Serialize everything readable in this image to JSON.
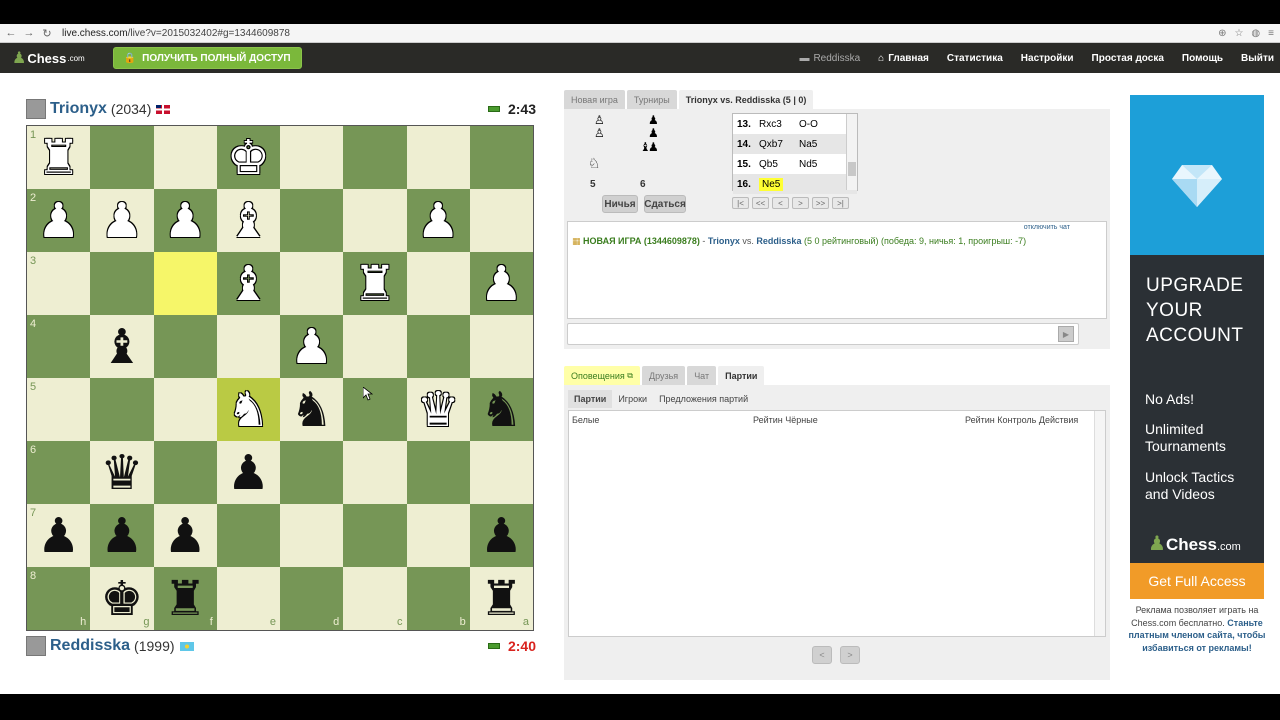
{
  "browser": {
    "url_host": "live.chess.com",
    "url_path": "/live?v=2015032402#g=1344609878",
    "back_icon": "back-arrow-icon",
    "forward_icon": "forward-arrow-icon",
    "reload_icon": "reload-icon"
  },
  "site": {
    "logo_text": "Chess",
    "logo_suffix": ".com",
    "full_access_label": "ПОЛУЧИТЬ ПОЛНЫЙ ДОСТУП",
    "nav": {
      "username": "Reddisska",
      "home": "Главная",
      "stats": "Статистика",
      "settings": "Настройки",
      "simple_board": "Простая доска",
      "help": "Помощь",
      "logout": "Выйти"
    }
  },
  "top_player": {
    "name": "Trionyx",
    "rating": "(2034)",
    "clock": "2:43",
    "clock_color": "#222222"
  },
  "bottom_player": {
    "name": "Reddisska",
    "rating": "(1999)",
    "clock": "2:40",
    "clock_color": "#d9231e"
  },
  "board": {
    "ranks": [
      "1",
      "2",
      "3",
      "4",
      "5",
      "6",
      "7",
      "8"
    ],
    "files": [
      "h",
      "g",
      "f",
      "e",
      "d",
      "c",
      "b",
      "a"
    ],
    "pieces": [
      [
        "wR",
        "",
        "",
        "wK",
        "",
        "",
        "",
        ""
      ],
      [
        "wP",
        "wP",
        "wP",
        "wB",
        "",
        "",
        "wP",
        ""
      ],
      [
        "",
        "",
        "",
        "wB",
        "",
        "wR",
        "",
        "wP"
      ],
      [
        "",
        "bB",
        "",
        "",
        "wP",
        "",
        "",
        ""
      ],
      [
        "",
        "",
        "",
        "wN",
        "bN",
        "",
        "wQ",
        "bN"
      ],
      [
        "",
        "bQ",
        "",
        "bP",
        "",
        "",
        "",
        ""
      ],
      [
        "bP",
        "bP",
        "bP",
        "",
        "",
        "",
        "",
        "bP"
      ],
      [
        "",
        "bK",
        "bR",
        "",
        "",
        "",
        "",
        "bR"
      ]
    ],
    "highlight": [
      [
        2,
        2
      ],
      [
        4,
        3
      ]
    ]
  },
  "panel": {
    "tabs": [
      "Новая игра",
      "Турниры",
      "Trionyx vs. Reddisska (5 | 0)"
    ],
    "captured_white_count": "5",
    "captured_black_count": "6",
    "draw_label": "Ничья",
    "resign_label": "Сдаться",
    "moves": [
      {
        "num": "13.",
        "white": "Rxc3",
        "black": "O-O"
      },
      {
        "num": "14.",
        "white": "Qxb7",
        "black": "Na5"
      },
      {
        "num": "15.",
        "white": "Qb5",
        "black": "Nd5"
      },
      {
        "num": "16.",
        "white": "Ne5",
        "black": ""
      }
    ],
    "nav_buttons": [
      "|<",
      "<<",
      "<",
      ">",
      ">>",
      ">|"
    ],
    "disable_chat": "отключить чат",
    "chat": {
      "new_game": "НОВАЯ ИГРА (1344609878)",
      "dash": " - ",
      "white": "Trionyx",
      "vs": " vs. ",
      "black": "Reddisska",
      "info": " (5 0 рейтинговый) (победа: 9, ничья: 1, проигрыш: -7)"
    }
  },
  "lower": {
    "tabs": [
      "Оповещения",
      "Друзья",
      "Чат",
      "Партии"
    ],
    "subtabs": [
      "Партии",
      "Игроки",
      "Предложения партий"
    ],
    "col_white": "Белые",
    "col_rating_black": "Рейтин Чёрные",
    "col_rating_control": "Рейтин Контроль Действия"
  },
  "ad": {
    "headline": [
      "UPGRADE",
      "YOUR",
      "ACCOUNT"
    ],
    "features": [
      "No Ads!",
      "Unlimited Tournaments",
      "Unlock Tactics and Videos"
    ],
    "logo_text": "Chess",
    "logo_suffix": ".com",
    "cta": "Get Full Access",
    "note": "Реклама позволяет играть на Chess.com бесплатно.",
    "note_link": "Станьте платным членом сайта, чтобы избавиться от рекламы!"
  },
  "colors": {
    "board_light": "#eeeed2",
    "board_dark": "#769656",
    "accent_green": "#7bb83b",
    "ad_orange": "#f19b28",
    "ad_blue": "#1d9fd8"
  }
}
